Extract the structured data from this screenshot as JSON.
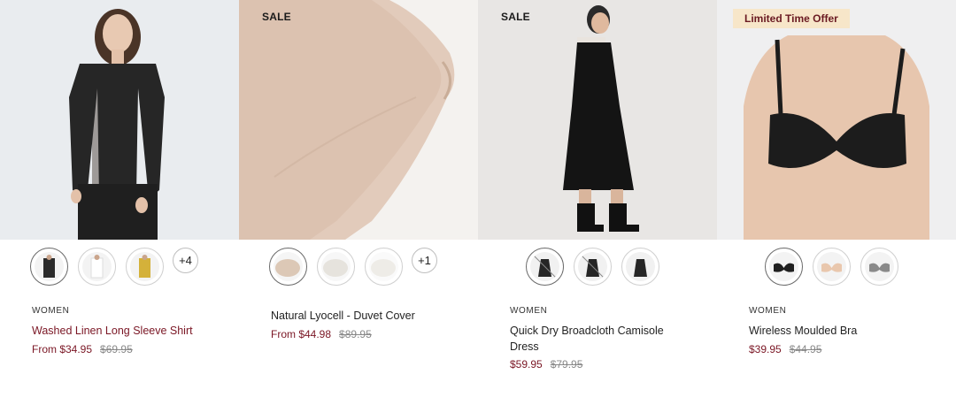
{
  "products": [
    {
      "category": "WOMEN",
      "name": "Washed Linen Long Sleeve Shirt",
      "price": "From $34.95",
      "old_price": "$69.95",
      "badge": "",
      "more_colors": "+4",
      "swatch_colors": [
        "#2b2b2b",
        "#efefef",
        "#d4b13a"
      ]
    },
    {
      "category": "",
      "name": "Natural Lyocell - Duvet Cover",
      "price": "From $44.98",
      "old_price": "$89.95",
      "badge": "SALE",
      "more_colors": "+1",
      "swatch_colors": [
        "#dcc8b6",
        "#e8e6e1",
        "#eeece7"
      ]
    },
    {
      "category": "WOMEN",
      "name": "Quick Dry Broadcloth Camisole Dress",
      "price": "$59.95",
      "old_price": "$79.95",
      "badge": "SALE",
      "more_colors": "",
      "swatch_colors": [
        "#262626",
        "#262626",
        "#262626"
      ]
    },
    {
      "category": "WOMEN",
      "name": "Wireless Moulded Bra",
      "price": "$39.95",
      "old_price": "$44.95",
      "badge": "Limited Time Offer",
      "more_colors": "",
      "swatch_colors": [
        "#1f1f1f",
        "#e9c7ad",
        "#8a8a8a"
      ]
    }
  ],
  "theme": {
    "price_color": "#7a1624",
    "offer_bg": "#f7e6c9"
  }
}
